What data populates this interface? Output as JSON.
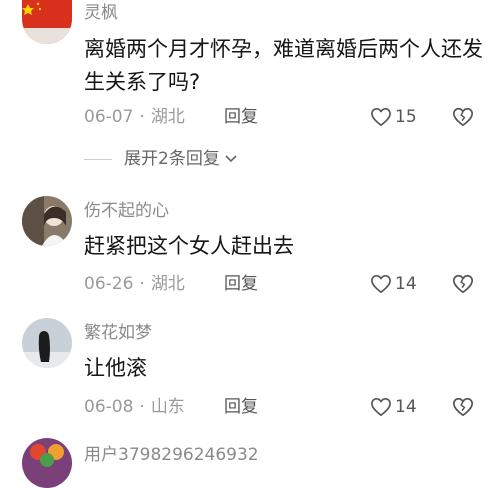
{
  "comments": [
    {
      "username": "灵枫",
      "text": "离婚两个月才怀孕，难道离婚后两个人还发生关系了吗?",
      "date": "06-07",
      "location": "湖北",
      "reply_label": "回复",
      "likes": "15",
      "avatar_icon": "flag-avatar-icon"
    },
    {
      "username": "伤不起的心",
      "text": "赶紧把这个女人赶出去",
      "date": "06-26",
      "location": "湖北",
      "reply_label": "回复",
      "likes": "14",
      "avatar_icon": "girl-photo-avatar-icon"
    },
    {
      "username": "繁花如梦",
      "text": "让他滚",
      "date": "06-08",
      "location": "山东",
      "reply_label": "回复",
      "likes": "14",
      "avatar_icon": "girl-silhouette-avatar-icon"
    },
    {
      "username": "用户3798296246932",
      "avatar_icon": "colorful-avatar-icon"
    }
  ],
  "expand_replies_label": "展开2条回复",
  "separator": "·",
  "colors": {
    "meta_text": "#9a9a9a",
    "username": "#8a8a8a",
    "body_text": "#161616"
  }
}
